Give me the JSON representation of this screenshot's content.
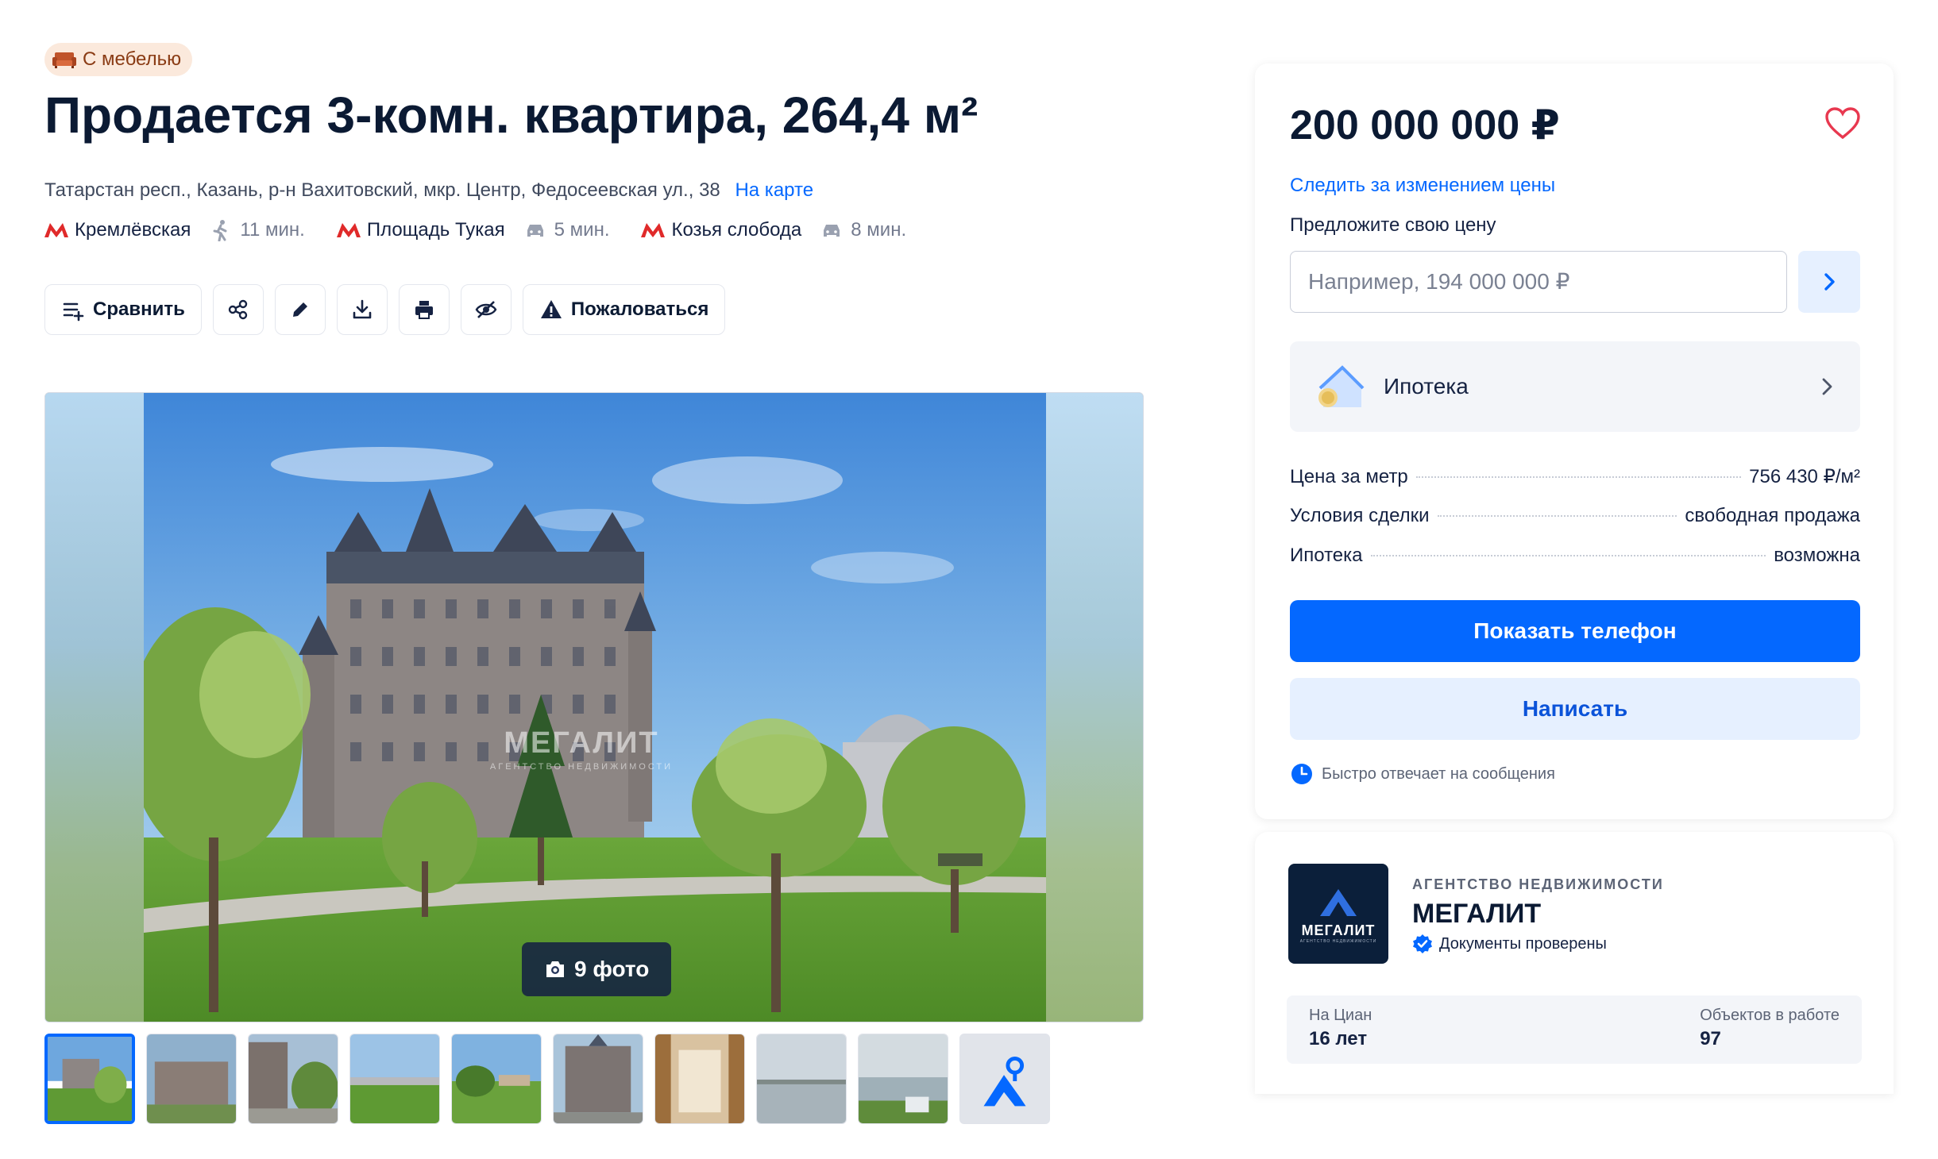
{
  "badge": {
    "label": "С мебелью",
    "icon": "sofa-icon"
  },
  "title": "Продается 3-комн. квартира, 264,4 м²",
  "address": {
    "text": "Татарстан респ., Казань, р-н Вахитовский, мкр. Центр, Федосеевская ул., 38",
    "map_link": "На карте"
  },
  "metro": [
    {
      "station": "Кремлёвская",
      "time": "11 мин.",
      "mode": "walk-icon"
    },
    {
      "station": "Площадь Тукая",
      "time": "5 мин.",
      "mode": "car-icon"
    },
    {
      "station": "Козья слобода",
      "time": "8 мин.",
      "mode": "car-icon"
    }
  ],
  "actions": {
    "compare": "Сравнить",
    "complain": "Пожаловаться"
  },
  "gallery": {
    "watermark": "МЕГАЛИТ",
    "watermark_sub": "АГЕНТСТВО НЕДВИЖИМОСТИ",
    "photo_count": "9 фото"
  },
  "price_card": {
    "price": "200 000 000 ₽",
    "watch_price": "Следить за изменением цены",
    "offer_label": "Предложите свою цену",
    "offer_placeholder": "Например, 194 000 000 ₽",
    "mortgage": "Ипотека",
    "params": [
      {
        "key": "Цена за метр",
        "value": "756 430 ₽/м²"
      },
      {
        "key": "Условия сделки",
        "value": "свободная продажа"
      },
      {
        "key": "Ипотека",
        "value": "возможна"
      }
    ],
    "show_phone": "Показать телефон",
    "write": "Написать",
    "fast_reply": "Быстро отвечает на сообщения"
  },
  "agency": {
    "type": "АГЕНТСТВО НЕДВИЖИМОСТИ",
    "name": "МЕГАЛИТ",
    "logo_text": "МЕГАЛИТ",
    "logo_sub": "АГЕНТСТВО НЕДВИЖИМОСТИ",
    "verified": "Документы проверены",
    "stats": [
      {
        "key": "На Циан",
        "value": "16 лет"
      },
      {
        "key": "Объектов в работе",
        "value": "97"
      }
    ]
  },
  "colors": {
    "accent": "#0468ff",
    "accent_light": "#e6f0ff",
    "text": "#152242",
    "metro_red": "#e02a2a",
    "badge_bg": "#fbe9dc",
    "favorite_red": "#e8384f"
  }
}
